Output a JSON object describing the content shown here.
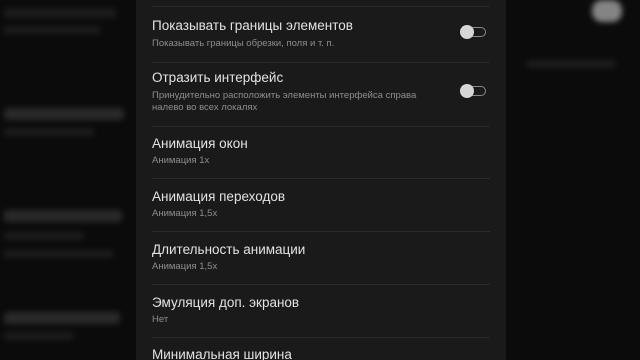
{
  "settings": {
    "items": [
      {
        "title": "Показывать границы элементов",
        "subtitle": "Показывать границы обрезки, поля и т. п.",
        "toggle": false
      },
      {
        "title": "Отразить интерфейс",
        "subtitle_line1": "Принудительно расположить элементы интерфейса справа",
        "subtitle_line2": "налево во всех локалях",
        "toggle": false
      },
      {
        "title": "Анимация окон",
        "subtitle": "Анимация 1x"
      },
      {
        "title": "Анимация переходов",
        "subtitle": "Анимация 1,5x"
      },
      {
        "title": "Длительность анимации",
        "subtitle": "Анимация 1,5x"
      },
      {
        "title": "Эмуляция доп. экранов",
        "subtitle": "Нет"
      },
      {
        "title": "Минимальная ширина"
      }
    ]
  },
  "colors": {
    "panel_background": "#1a1a1a",
    "title_text": "#e3e3e3",
    "subtitle_text": "#8e8e8e",
    "divider": "#2b2b2b",
    "toggle_thumb": "#d6d6d6"
  }
}
